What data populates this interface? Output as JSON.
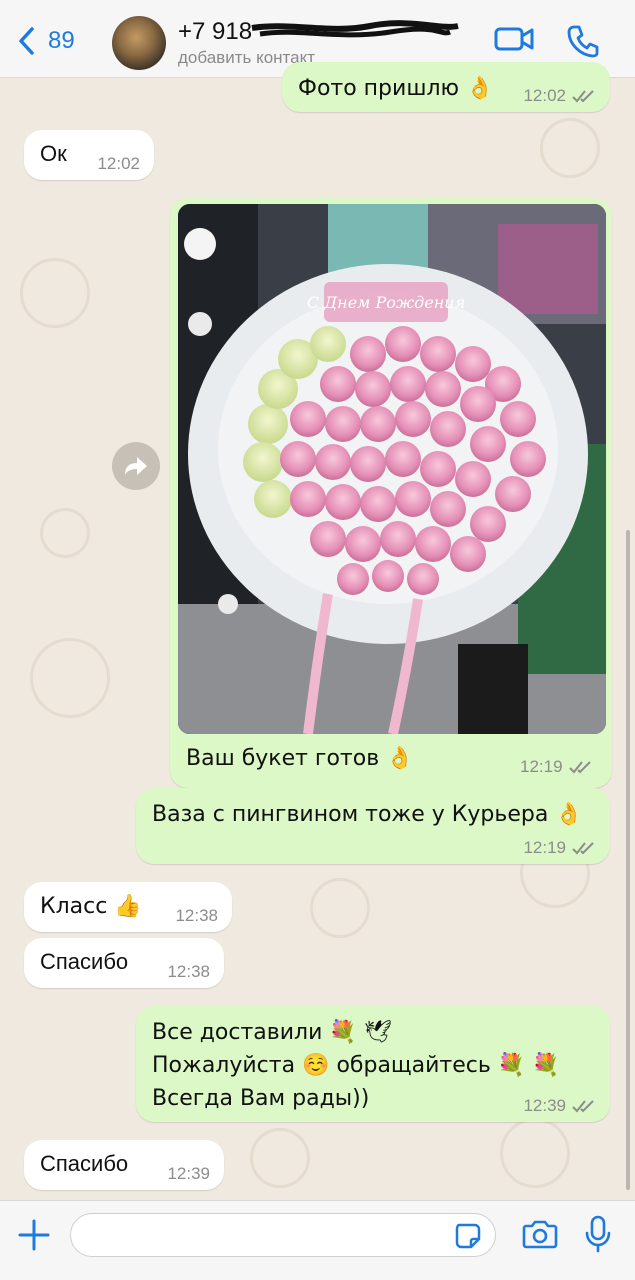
{
  "header": {
    "back_count": "89",
    "contact_name": "+7 918",
    "contact_subtitle": "добавить контакт"
  },
  "messages": [
    {
      "id": "m1",
      "dir": "out",
      "text": "Фото пришлю 👌",
      "time": "12:02",
      "read": true
    },
    {
      "id": "m2",
      "dir": "in",
      "text": "Ок",
      "time": "12:02"
    },
    {
      "id": "m3",
      "dir": "out",
      "type": "photo",
      "photo_label": "С Днем Рождения",
      "caption": "Ваш букет готов 👌",
      "time": "12:19",
      "read": true
    },
    {
      "id": "m4",
      "dir": "out",
      "text": "Ваза с пингвином тоже у Курьера 👌",
      "time": "12:19",
      "read": true
    },
    {
      "id": "m5",
      "dir": "in",
      "text": "Класс 👍",
      "time": "12:38"
    },
    {
      "id": "m6",
      "dir": "in",
      "text": "Спасибо",
      "time": "12:38"
    },
    {
      "id": "m7",
      "dir": "out",
      "text": "Все доставили 💐 🕊\nПожалуйста ☺️ обращайтесь 💐 💐\nВсегда Вам рады))",
      "time": "12:39",
      "read": true
    },
    {
      "id": "m8",
      "dir": "in",
      "text": "Спасибо",
      "time": "12:39"
    }
  ],
  "composer": {
    "placeholder": ""
  },
  "colors": {
    "accent": "#1f7ae0",
    "outgoing_bubble": "#dcf8c6",
    "incoming_bubble": "#ffffff",
    "chat_background": "#efe9e0"
  },
  "icons": [
    "back-chevron-icon",
    "video-call-icon",
    "phone-icon",
    "forward-icon",
    "plus-icon",
    "sticker-icon",
    "camera-icon",
    "microphone-icon",
    "read-ticks-icon"
  ]
}
